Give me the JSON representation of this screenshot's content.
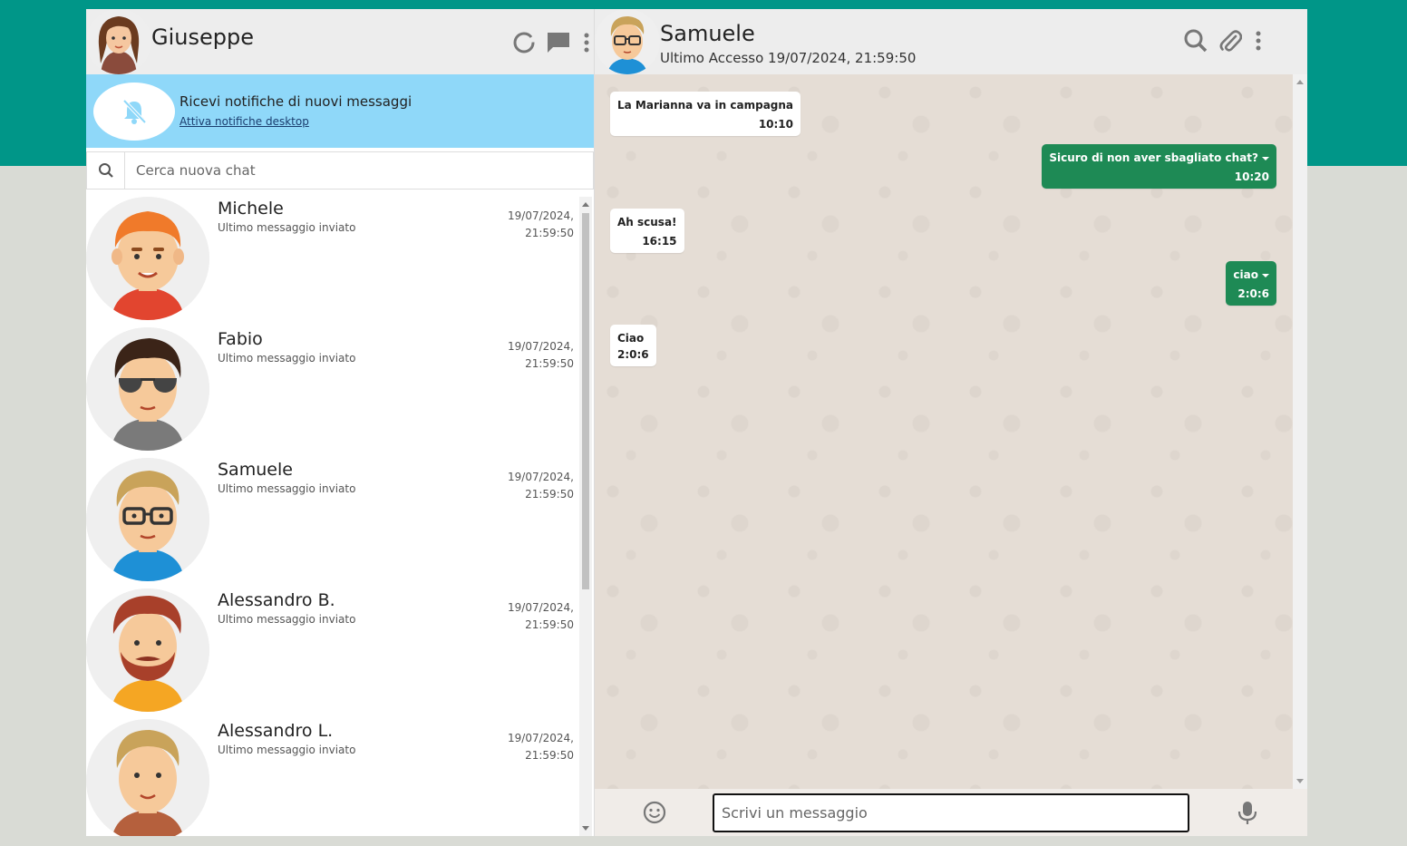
{
  "me": {
    "name": "Giuseppe"
  },
  "header_icons": [
    "status-icon",
    "new-chat-icon",
    "menu-icon"
  ],
  "notification": {
    "title": "Ricevi notifiche di nuovi messaggi",
    "link": "Attiva notifiche desktop"
  },
  "search": {
    "placeholder": "Cerca nuova chat"
  },
  "chats": [
    {
      "name": "Michele",
      "last": "Ultimo messaggio inviato",
      "date": "19/07/2024,",
      "time": "21:59:50"
    },
    {
      "name": "Fabio",
      "last": "Ultimo messaggio inviato",
      "date": "19/07/2024,",
      "time": "21:59:50"
    },
    {
      "name": "Samuele",
      "last": "Ultimo messaggio inviato",
      "date": "19/07/2024,",
      "time": "21:59:50"
    },
    {
      "name": "Alessandro B.",
      "last": "Ultimo messaggio inviato",
      "date": "19/07/2024,",
      "time": "21:59:50"
    },
    {
      "name": "Alessandro L.",
      "last": "Ultimo messaggio inviato",
      "date": "19/07/2024,",
      "time": "21:59:50"
    }
  ],
  "contact": {
    "name": "Samuele",
    "status": "Ultimo Accesso 19/07/2024, 21:59:50"
  },
  "messages": [
    {
      "dir": "in",
      "text": "La Marianna va in campagna",
      "time": "10:10"
    },
    {
      "dir": "out",
      "text": "Sicuro di non aver sbagliato chat?",
      "time": "10:20"
    },
    {
      "dir": "in",
      "text": "Ah scusa!",
      "time": "16:15"
    },
    {
      "dir": "out",
      "text": "ciao",
      "time": "2:0:6"
    },
    {
      "dir": "in",
      "text": "Ciao",
      "time": "2:0:6"
    }
  ],
  "composer": {
    "placeholder": "Scrivi un messaggio"
  },
  "colors": {
    "teal": "#009688",
    "sent": "#1e8a55",
    "notif": "#8fd8f9",
    "chat_bg": "#e5ddd5"
  }
}
